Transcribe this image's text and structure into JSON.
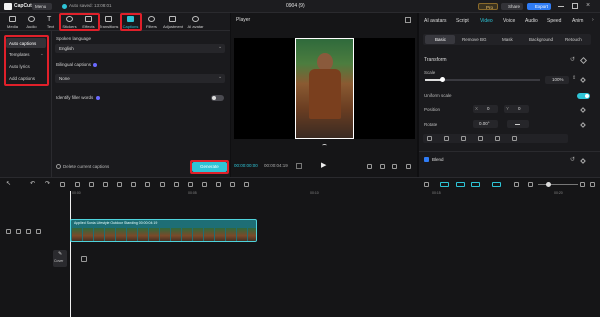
{
  "titlebar": {
    "app_name": "CapCut",
    "menu_label": "Menu",
    "autosave": "Auto saved: 13:08:01",
    "project_name": "0904 (9)",
    "pro_label": "Pro",
    "share_label": "Share",
    "export_label": "Export"
  },
  "toolbar": {
    "items": [
      {
        "label": "Media"
      },
      {
        "label": "Audio"
      },
      {
        "label": "Text"
      },
      {
        "label": "Stickers"
      },
      {
        "label": "Effects"
      },
      {
        "label": "Transitions"
      },
      {
        "label": "Captions"
      },
      {
        "label": "Filters"
      },
      {
        "label": "Adjustment"
      },
      {
        "label": "AI avatar"
      }
    ]
  },
  "left_sidebar": {
    "items": [
      {
        "label": "Auto captions"
      },
      {
        "label": "Templates"
      },
      {
        "label": "Auto lyrics"
      },
      {
        "label": "Add captions"
      }
    ]
  },
  "captions_panel": {
    "spoken_language_label": "Spoken language",
    "spoken_language_value": "English",
    "bilingual_label": "Bilingual captions",
    "bilingual_value": "None",
    "filler_label": "Identify filler words",
    "delete_label": "Delete current captions",
    "generate_label": "Generate"
  },
  "player": {
    "title": "Player",
    "current_time": "00:00:00:00",
    "total_time": "00:00:04:19"
  },
  "right_panel": {
    "tabs": [
      "AI avatars",
      "Script",
      "Video",
      "Voice",
      "Audio",
      "Speed",
      "Anim"
    ],
    "active_tab": "Video",
    "subtabs": [
      "Basic",
      "Remove BG",
      "Mask",
      "Background",
      "Retouch"
    ],
    "transform_label": "Transform",
    "scale_label": "Scale",
    "scale_value": "100%",
    "scale_fraction": 0.15,
    "uniform_scale_label": "Uniform scale",
    "position_label": "Position",
    "pos_x_label": "X",
    "pos_x_value": "0",
    "pos_y_label": "Y",
    "pos_y_value": "0",
    "rotate_label": "Rotate",
    "rotate_value": "0.00°",
    "blend_label": "Blend"
  },
  "timeline": {
    "ruler": [
      "00:00",
      "00:05",
      "00:10",
      "00:15",
      "00:20",
      "00:25"
    ],
    "clip_label": "Applied   Sonia Lifestyle Outdoor Standing  00:00:04:19",
    "cover_label": "Cover"
  },
  "colors": {
    "accent": "#2ec4d6",
    "highlight": "#e0202a",
    "export": "#2f7cf6"
  }
}
